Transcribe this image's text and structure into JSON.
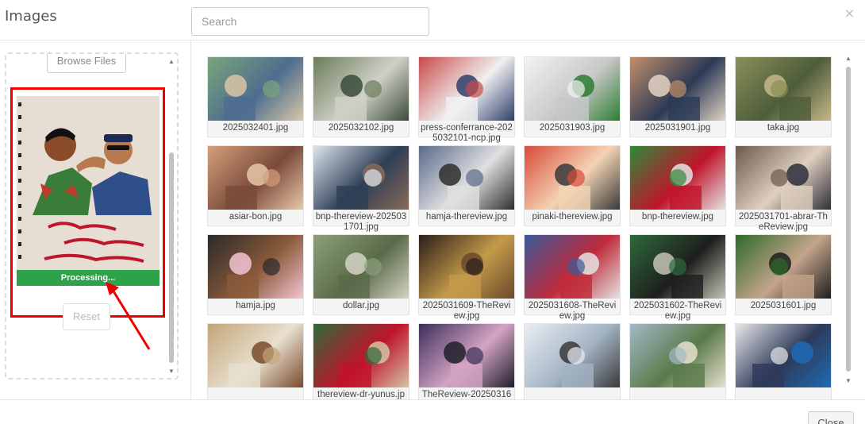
{
  "modal": {
    "title": "Images",
    "close_symbol": "×",
    "search": {
      "placeholder": "Search",
      "value": ""
    }
  },
  "uploader": {
    "browse_label": "Browse Files",
    "processing_label": "Processing...",
    "reset_label": "Reset",
    "preview_icon": "image-preview"
  },
  "images": [
    {
      "caption": "2025032401.jpg"
    },
    {
      "caption": "2025032102.jpg"
    },
    {
      "caption": "press-conferrance-2025032101-ncp.jpg"
    },
    {
      "caption": "2025031903.jpg"
    },
    {
      "caption": "2025031901.jpg"
    },
    {
      "caption": "taka.jpg"
    },
    {
      "caption": "asiar-bon.jpg"
    },
    {
      "caption": "bnp-thereview-2025031701.jpg"
    },
    {
      "caption": "hamja-thereview.jpg"
    },
    {
      "caption": "pinaki-thereview.jpg"
    },
    {
      "caption": "bnp-thereview.jpg"
    },
    {
      "caption": "2025031701-abrar-TheReview.jpg"
    },
    {
      "caption": "hamja.jpg"
    },
    {
      "caption": "dollar.jpg"
    },
    {
      "caption": "2025031609-TheReview.jpg"
    },
    {
      "caption": "2025031608-TheReview.jpg"
    },
    {
      "caption": "2025031602-TheReview.jpg"
    },
    {
      "caption": "2025031601.jpg"
    },
    {
      "caption": ""
    },
    {
      "caption": ""
    },
    {
      "caption": ""
    },
    {
      "caption": ""
    },
    {
      "caption": ""
    },
    {
      "caption": ""
    }
  ],
  "row4_captions": [
    "",
    "thereview-dr-yunus.jp",
    "TheReview-202503160",
    "",
    "",
    ""
  ],
  "footer": {
    "close_label": "Close"
  },
  "colors": {
    "processing": "#2ea24a",
    "highlight": "#e00000"
  }
}
